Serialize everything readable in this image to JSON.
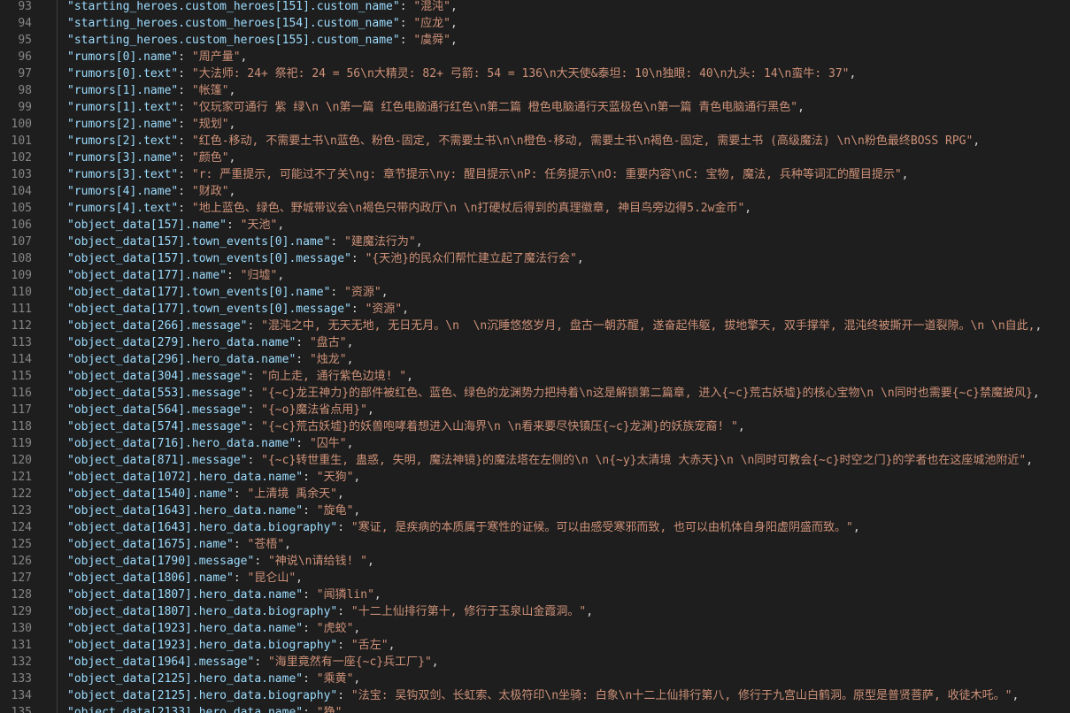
{
  "editor": {
    "language": "json",
    "colors": {
      "background": "#1e1e1e",
      "line_number": "#858585",
      "key": "#9cdcfe",
      "string": "#ce9178",
      "punctuation": "#d4d4d4"
    },
    "lines": [
      {
        "num": "93",
        "key": "\"starting_heroes.custom_heroes[151].custom_name\"",
        "value": "\"混沌\""
      },
      {
        "num": "94",
        "key": "\"starting_heroes.custom_heroes[154].custom_name\"",
        "value": "\"应龙\""
      },
      {
        "num": "95",
        "key": "\"starting_heroes.custom_heroes[155].custom_name\"",
        "value": "\"虞舜\""
      },
      {
        "num": "96",
        "key": "\"rumors[0].name\"",
        "value": "\"周产量\""
      },
      {
        "num": "97",
        "key": "\"rumors[0].text\"",
        "value": "\"大法师: 24+ 祭祀: 24 = 56\\n大精灵: 82+ 弓箭: 54 = 136\\n大天使&泰坦: 10\\n独眼: 40\\n九头: 14\\n蛮牛: 37\""
      },
      {
        "num": "98",
        "key": "\"rumors[1].name\"",
        "value": "\"帐篷\""
      },
      {
        "num": "99",
        "key": "\"rumors[1].text\"",
        "value": "\"仅玩家可通行 紫 绿\\n \\n第一篇 红色电脑通行红色\\n第二篇 橙色电脑通行天蓝极色\\n第一篇 青色电脑通行黑色\""
      },
      {
        "num": "100",
        "key": "\"rumors[2].name\"",
        "value": "\"规划\""
      },
      {
        "num": "101",
        "key": "\"rumors[2].text\"",
        "value": "\"红色-移动, 不需要土书\\n蓝色、粉色-固定, 不需要土书\\n\\n橙色-移动, 需要土书\\n褐色-固定, 需要土书 (高级魔法) \\n\\n粉色最终BOSS RPG\""
      },
      {
        "num": "102",
        "key": "\"rumors[3].name\"",
        "value": "\"颜色\""
      },
      {
        "num": "103",
        "key": "\"rumors[3].text\"",
        "value": "\"r: 严重提示, 可能过不了关\\ng: 章节提示\\ny: 醒目提示\\nP: 任务提示\\nO: 重要内容\\nC: 宝物, 魔法, 兵种等词汇的醒目提示\""
      },
      {
        "num": "104",
        "key": "\"rumors[4].name\"",
        "value": "\"财政\""
      },
      {
        "num": "105",
        "key": "\"rumors[4].text\"",
        "value": "\"地上蓝色、绿色、野城带议会\\n褐色只带内政厅\\n \\n打硬杖后得到的真理徽章, 神目鸟旁边得5.2w金币\""
      },
      {
        "num": "106",
        "key": "\"object_data[157].name\"",
        "value": "\"天池\""
      },
      {
        "num": "107",
        "key": "\"object_data[157].town_events[0].name\"",
        "value": "\"建魔法行为\""
      },
      {
        "num": "108",
        "key": "\"object_data[157].town_events[0].message\"",
        "value": "\"{天池}的民众们帮忙建立起了魔法行会\""
      },
      {
        "num": "109",
        "key": "\"object_data[177].name\"",
        "value": "\"归墟\""
      },
      {
        "num": "110",
        "key": "\"object_data[177].town_events[0].name\"",
        "value": "\"资源\""
      },
      {
        "num": "111",
        "key": "\"object_data[177].town_events[0].message\"",
        "value": "\"资源\""
      },
      {
        "num": "112",
        "key": "\"object_data[266].message\"",
        "value": "\"混沌之中, 无天无地, 无日无月。\\n  \\n沉睡悠悠岁月, 盘古一朝苏醒, 遂奋起伟躯, 拔地擎天, 双手撑举, 混沌终被撕开一道裂隙。\\n \\n自此,"
      },
      {
        "num": "113",
        "key": "\"object_data[279].hero_data.name\"",
        "value": "\"盘古\""
      },
      {
        "num": "114",
        "key": "\"object_data[296].hero_data.name\"",
        "value": "\"烛龙\""
      },
      {
        "num": "115",
        "key": "\"object_data[304].message\"",
        "value": "\"向上走, 通行紫色边境! \""
      },
      {
        "num": "116",
        "key": "\"object_data[553].message\"",
        "value": "\"{~c}龙王神力}的部件被红色、蓝色、绿色的龙渊势力把持着\\n这是解锁第二篇章, 进入{~c}荒古妖墟}的核心宝物\\n \\n同时也需要{~c}禁魔披风}"
      },
      {
        "num": "117",
        "key": "\"object_data[564].message\"",
        "value": "\"{~o}魔法省点用}\""
      },
      {
        "num": "118",
        "key": "\"object_data[574].message\"",
        "value": "\"{~c}荒古妖墟}的妖兽咆哮着想进入山海界\\n \\n看来要尽快镇压{~c}龙渊}的妖族宠裔! \""
      },
      {
        "num": "119",
        "key": "\"object_data[716].hero_data.name\"",
        "value": "\"囚牛\""
      },
      {
        "num": "120",
        "key": "\"object_data[871].message\"",
        "value": "\"{~c}转世重生, 蛊惑, 失明, 魔法神镜}的魔法塔在左侧的\\n \\n{~y}太清境 大赤天}\\n \\n同时可教会{~c}时空之门}的学者也在这座城池附近\""
      },
      {
        "num": "121",
        "key": "\"object_data[1072].hero_data.name\"",
        "value": "\"天狗\""
      },
      {
        "num": "122",
        "key": "\"object_data[1540].name\"",
        "value": "\"上清境 禹余天\""
      },
      {
        "num": "123",
        "key": "\"object_data[1643].hero_data.name\"",
        "value": "\"旋龟\""
      },
      {
        "num": "124",
        "key": "\"object_data[1643].hero_data.biography\"",
        "value": "\"寒证, 是疾病的本质属于寒性的证候。可以由感受寒邪而致, 也可以由机体自身阳虚阴盛而致。\""
      },
      {
        "num": "125",
        "key": "\"object_data[1675].name\"",
        "value": "\"苍梧\""
      },
      {
        "num": "126",
        "key": "\"object_data[1790].message\"",
        "value": "\"神说\\n请给钱! \""
      },
      {
        "num": "127",
        "key": "\"object_data[1806].name\"",
        "value": "\"昆仑山\""
      },
      {
        "num": "128",
        "key": "\"object_data[1807].hero_data.name\"",
        "value": "\"闻獜lin\""
      },
      {
        "num": "129",
        "key": "\"object_data[1807].hero_data.biography\"",
        "value": "\"十二上仙排行第十, 修行于玉泉山金霞洞。\""
      },
      {
        "num": "130",
        "key": "\"object_data[1923].hero_data.name\"",
        "value": "\"虎蛟\""
      },
      {
        "num": "131",
        "key": "\"object_data[1923].hero_data.biography\"",
        "value": "\"舌左\""
      },
      {
        "num": "132",
        "key": "\"object_data[1964].message\"",
        "value": "\"海里竟然有一座{~c}兵工厂}\""
      },
      {
        "num": "133",
        "key": "\"object_data[2125].hero_data.name\"",
        "value": "\"乘黄\""
      },
      {
        "num": "134",
        "key": "\"object_data[2125].hero_data.biography\"",
        "value": "\"法宝: 吴钩双剑、长虹索、太极符印\\n坐骑: 白象\\n十二上仙排行第八, 修行于九宫山白鹤洞。原型是普贤菩萨, 收徒木吒。\""
      },
      {
        "num": "135",
        "key": "\"object_data[2133].hero_data.name\"",
        "value": "\"狰\""
      }
    ]
  }
}
